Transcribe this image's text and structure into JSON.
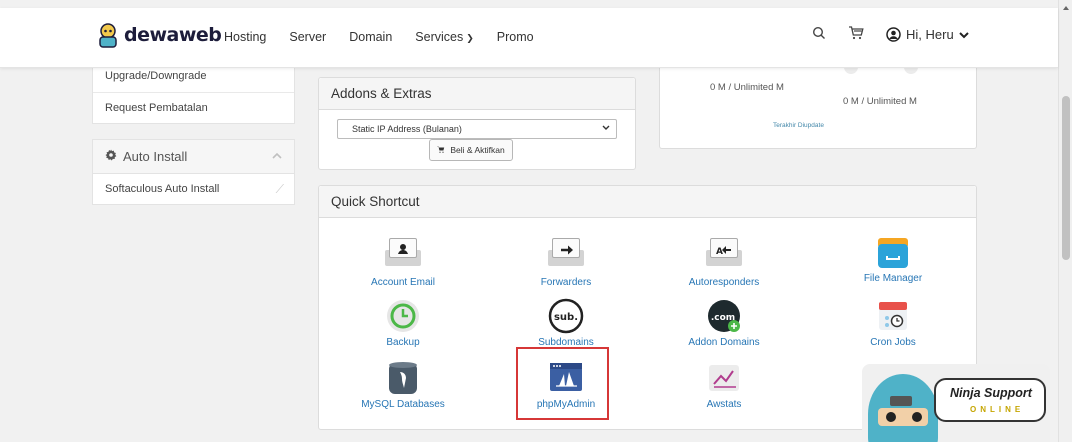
{
  "brand": {
    "name": "dewaweb"
  },
  "nav": {
    "items": [
      "Hosting",
      "Server",
      "Domain",
      "Services",
      "Promo"
    ],
    "services_chevron": "⌄"
  },
  "header": {
    "search_icon": "search-icon",
    "cart_icon": "cart-icon",
    "user_label": "Hi, Heru"
  },
  "sidebar": {
    "links": [
      "Upgrade/Downgrade",
      "Request Pembatalan"
    ],
    "auto_install": {
      "title": "Auto Install",
      "items": [
        "Softaculous Auto Install"
      ]
    }
  },
  "addons": {
    "title": "Addons & Extras",
    "select_value": "Static IP Address (Bulanan)",
    "button_label": "Beli & Aktifkan"
  },
  "usage": {
    "stat1": "0 M / Unlimited M",
    "stat2": "0 M / Unlimited M",
    "updated": "Terakhir Diupdate"
  },
  "shortcuts": {
    "title": "Quick Shortcut",
    "items": [
      "Account Email",
      "Forwarders",
      "Autoresponders",
      "File Manager",
      "Backup",
      "Subdomains",
      "Addon Domains",
      "Cron Jobs",
      "MySQL Databases",
      "phpMyAdmin",
      "Awstats"
    ]
  },
  "ninja": {
    "title": "Ninja Support",
    "status": "ONLINE"
  },
  "colors": {
    "link": "#2776b5",
    "highlight": "#d63737",
    "brand": "#1d1d3b"
  }
}
